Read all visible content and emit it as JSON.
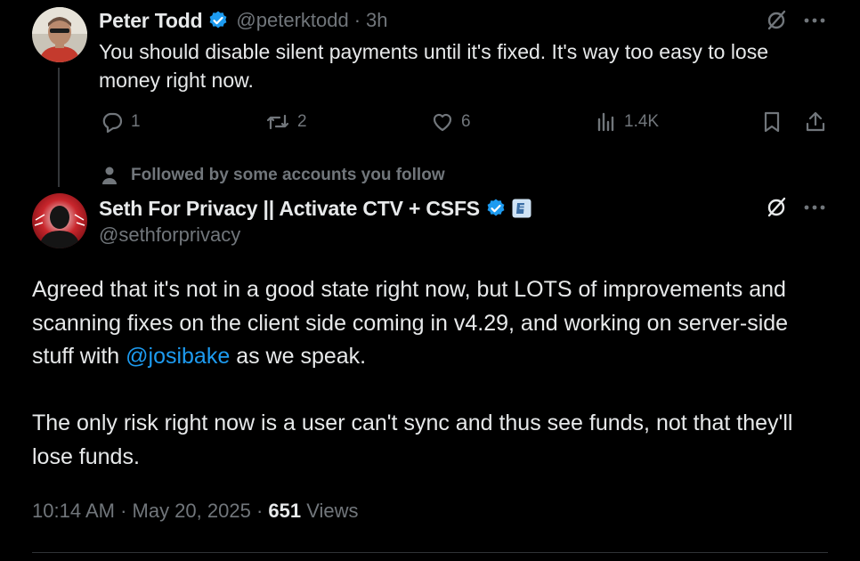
{
  "reply_parent": {
    "author_name": "Peter Todd",
    "handle": "@peterktodd",
    "separator": "·",
    "time": "3h",
    "text": "You should disable silent payments until it's fixed. It's way too easy to lose money right now.",
    "actions": {
      "replies": "1",
      "reposts": "2",
      "likes": "6",
      "views": "1.4K"
    }
  },
  "social_context": "Followed by some accounts you follow",
  "main_post": {
    "author_name": "Seth For Privacy || Activate CTV + CSFS",
    "handle": "@sethforprivacy",
    "text_before_link": "Agreed that it's not in a good state right now, but LOTS of improvements and scanning fixes on the client side coming in v4.29, and working on server-side stuff with ",
    "mention": "@josibake",
    "text_after_link": " as we speak.",
    "text_paragraph_2": "The only risk right now is a user can't sync and thus see funds, not that they'll lose funds.",
    "timestamp": "10:14 AM · May 20, 2025",
    "meta_separator": " · ",
    "views_count": "651",
    "views_label": " Views"
  },
  "icons": {
    "verified": "verified-badge-icon",
    "affiliate": "affiliate-badge-icon",
    "grok": "grok-icon",
    "more": "more-icon",
    "reply": "reply-icon",
    "repost": "repost-icon",
    "like": "like-icon",
    "views": "views-icon",
    "bookmark": "bookmark-icon",
    "share": "share-icon",
    "person": "person-icon"
  },
  "colors": {
    "background": "#000000",
    "text": "#e7e9ea",
    "muted": "#71767b",
    "accent": "#1d9bf0"
  }
}
